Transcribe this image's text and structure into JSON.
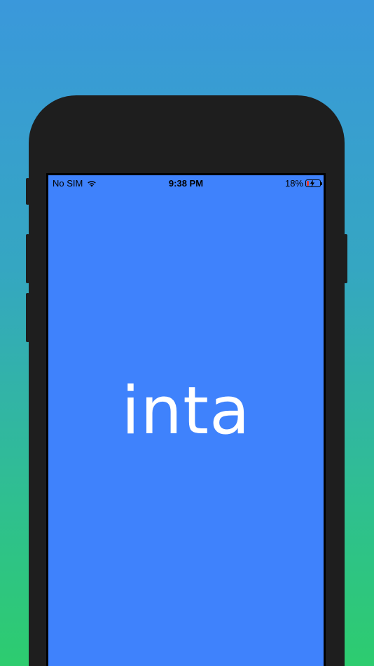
{
  "status_bar": {
    "carrier": "No SIM",
    "time": "9:38 PM",
    "battery_percent": "18%",
    "battery_level": 0.18,
    "charging": true,
    "wifi_icon": "wifi-icon",
    "battery_icon": "battery-charging-icon"
  },
  "app": {
    "logo_text": "inta"
  },
  "colors": {
    "screen_background": "#3f82fc",
    "logo_text": "#ffffff",
    "battery_low": "#e53935",
    "background_top": "#3a98db",
    "background_bottom": "#2dcc6f"
  }
}
